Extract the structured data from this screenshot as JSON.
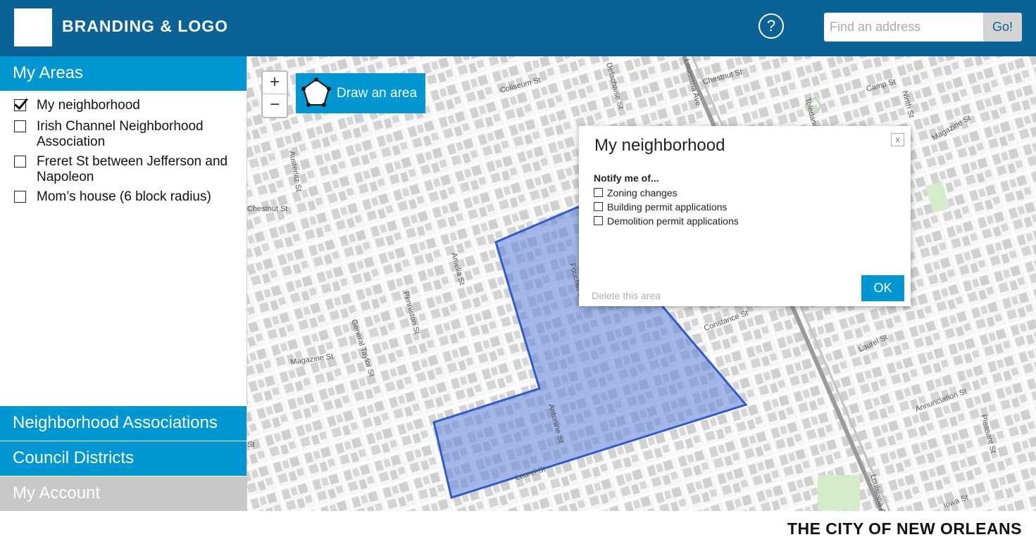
{
  "header": {
    "brand": "BRANDING & LOGO",
    "help_icon": "?",
    "search_placeholder": "Find an address",
    "go_label": "Go!"
  },
  "sidebar": {
    "my_areas_label": "My Areas",
    "areas": [
      {
        "label": "My neighborhood",
        "checked": true
      },
      {
        "label": "Irish Channel Neighborhood Association",
        "checked": false
      },
      {
        "label": "Freret St between Jefferson and Napoleon",
        "checked": false
      },
      {
        "label": "Mom’s house (6 block radius)",
        "checked": false
      }
    ],
    "sections": [
      {
        "label": "Neighborhood Associations"
      },
      {
        "label": "Council Districts"
      },
      {
        "label": "My Account"
      }
    ]
  },
  "map": {
    "zoom_in": "+",
    "zoom_out": "−",
    "draw_label": "Draw an area",
    "streets": [
      "Coliseum St",
      "Delachaise St",
      "Louisiana Ave",
      "Chestnut St",
      "Camp St",
      "Ninth St",
      "Magazine St",
      "Toledano",
      "Austerlitz St",
      "Chestnut St",
      "Amelia St",
      "Penniston St",
      "General Taylor St",
      "Magazine St",
      "Antonine St",
      "Foucher St",
      "Laurel St",
      "Constance St",
      "Laurel St",
      "Annunciation St",
      "Pleasant St",
      "Louisiana Ave",
      "Iowa St",
      "Valmont St",
      "Chestnut St",
      "Delachaise St",
      "Laurel St",
      "St"
    ],
    "colors": {
      "area_fill": "#5b80d8",
      "area_stroke": "#2e5bcf",
      "map_bg": "#f2f2f2"
    }
  },
  "popup": {
    "title": "My neighborhood",
    "close": "x",
    "notify_heading": "Notify me of...",
    "options": [
      "Zoning changes",
      "Building permit applications",
      "Demolition permit applications"
    ],
    "delete_label": "Delete this area",
    "ok_label": "OK"
  },
  "footer": {
    "city": "THE CITY OF NEW ORLEANS"
  },
  "colors": {
    "header": "#0a6296",
    "accent": "#0097d2",
    "disabled": "#c8c8c8"
  }
}
